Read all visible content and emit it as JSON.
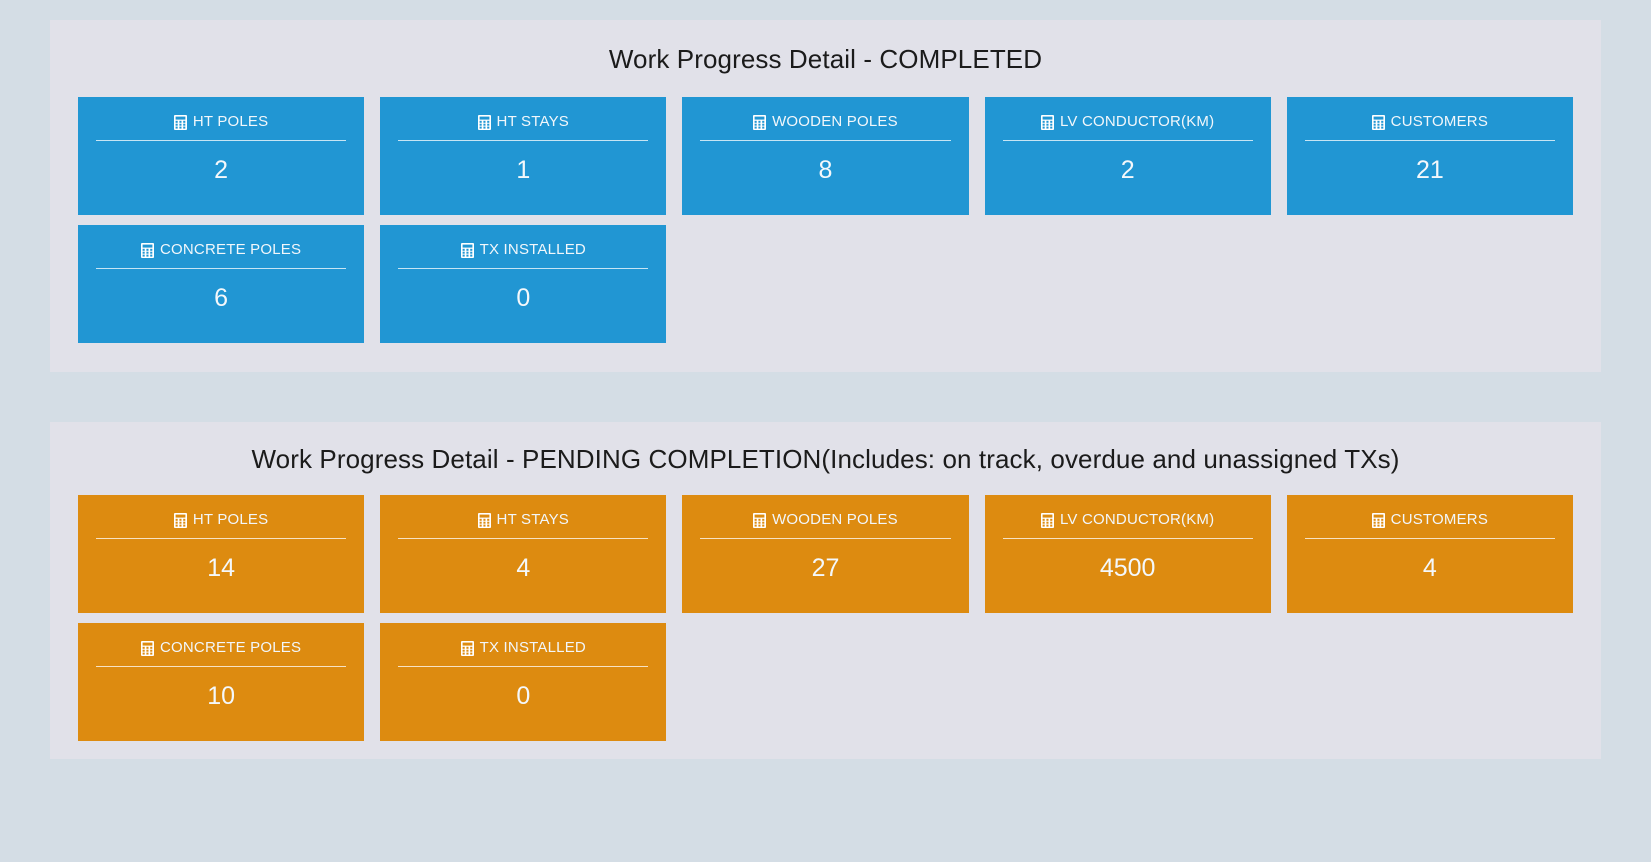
{
  "colors": {
    "page_background": "#d4dde5",
    "panel_background": "#e1e1e9",
    "completed_card": "#2196d3",
    "pending_card": "#dd8b10",
    "title_text": "#1b1b1b",
    "card_text": "#ffffff"
  },
  "sections": [
    {
      "id": "completed",
      "title": "Work Progress Detail - COMPLETED",
      "variant": "blue",
      "cards": [
        {
          "icon": "calculator-icon",
          "label": "HT POLES",
          "value": "2"
        },
        {
          "icon": "calculator-icon",
          "label": "HT STAYS",
          "value": "1"
        },
        {
          "icon": "calculator-icon",
          "label": "WOODEN POLES",
          "value": "8"
        },
        {
          "icon": "calculator-icon",
          "label": "LV CONDUCTOR(KM)",
          "value": "2"
        },
        {
          "icon": "calculator-icon",
          "label": "CUSTOMERS",
          "value": "21"
        },
        {
          "icon": "calculator-icon",
          "label": "CONCRETE POLES",
          "value": "6"
        },
        {
          "icon": "calculator-icon",
          "label": "TX INSTALLED",
          "value": "0"
        }
      ]
    },
    {
      "id": "pending",
      "title": "Work Progress Detail - PENDING COMPLETION(Includes: on track, overdue and unassigned TXs)",
      "variant": "orange",
      "cards": [
        {
          "icon": "calculator-icon",
          "label": "HT POLES",
          "value": "14"
        },
        {
          "icon": "calculator-icon",
          "label": "HT STAYS",
          "value": "4"
        },
        {
          "icon": "calculator-icon",
          "label": "WOODEN POLES",
          "value": "27"
        },
        {
          "icon": "calculator-icon",
          "label": "LV CONDUCTOR(KM)",
          "value": "4500"
        },
        {
          "icon": "calculator-icon",
          "label": "CUSTOMERS",
          "value": "4"
        },
        {
          "icon": "calculator-icon",
          "label": "CONCRETE POLES",
          "value": "10"
        },
        {
          "icon": "calculator-icon",
          "label": "TX INSTALLED",
          "value": "0"
        }
      ]
    }
  ]
}
